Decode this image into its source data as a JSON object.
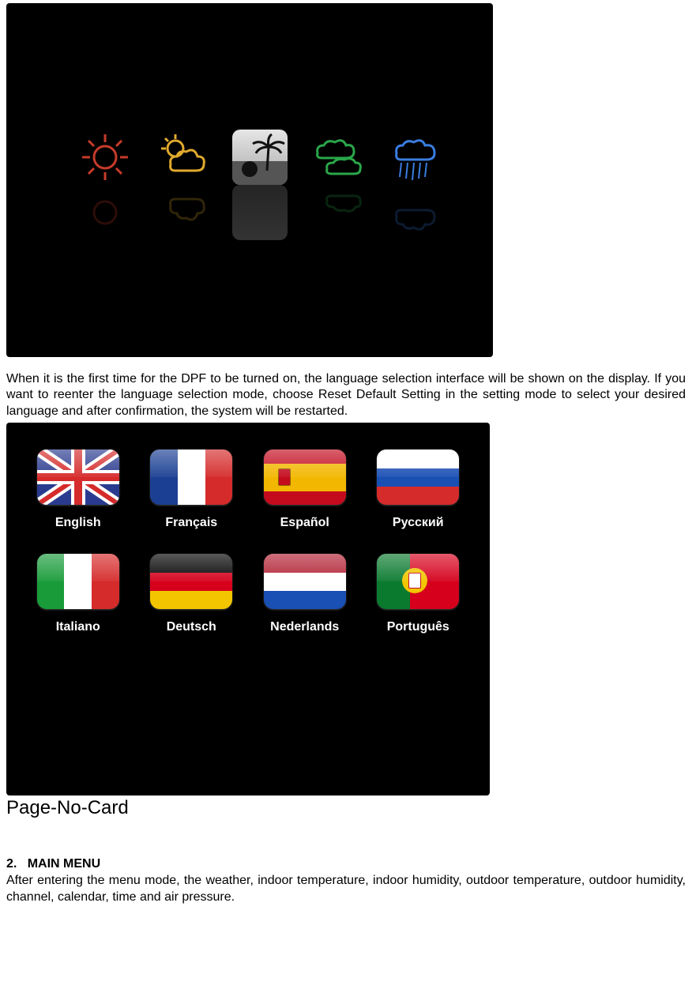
{
  "weather_icons": [
    {
      "name": "sun-outline-icon"
    },
    {
      "name": "sun-cloud-icon"
    },
    {
      "name": "palm-photo-icon"
    },
    {
      "name": "green-clouds-icon"
    },
    {
      "name": "rain-cloud-icon"
    }
  ],
  "paragraph1": "When it is the first time for the DPF to be turned on, the language selection interface will be shown on the display. If you want to reenter the language selection mode, choose Reset Default Setting in the setting mode to select your desired language and after confirmation, the system will be restarted.",
  "languages": [
    {
      "label": "English",
      "flag": "uk"
    },
    {
      "label": "Français",
      "flag": "fr"
    },
    {
      "label": "Español",
      "flag": "es"
    },
    {
      "label": "Русский",
      "flag": "ru"
    },
    {
      "label": "Italiano",
      "flag": "it"
    },
    {
      "label": "Deutsch",
      "flag": "de"
    },
    {
      "label": "Nederlands",
      "flag": "nl"
    },
    {
      "label": "Português",
      "flag": "pt"
    }
  ],
  "page_label": "Page-No-Card",
  "section2_number": "2.",
  "section2_title": "MAIN MENU",
  "section2_body": "After entering the menu mode, the weather, indoor temperature, indoor humidity, outdoor temperature, outdoor humidity, channel, calendar, time and air pressure."
}
